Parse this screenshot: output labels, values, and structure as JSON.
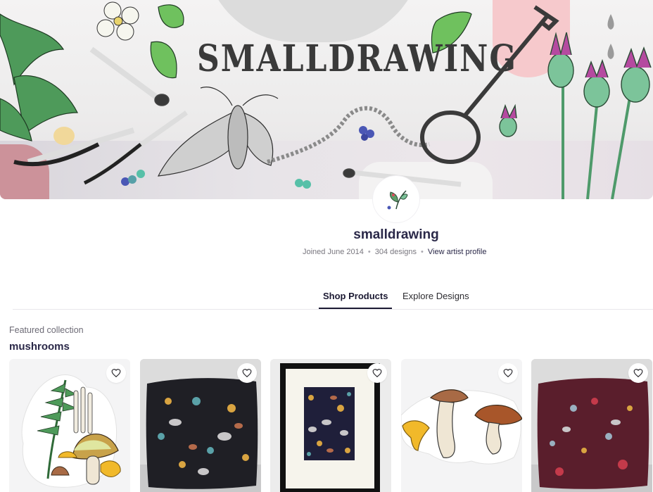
{
  "banner": {
    "title": "SMALLDRAWING"
  },
  "artist": {
    "name": "smalldrawing",
    "joined": "Joined June 2014",
    "designs": "304 designs",
    "profile_link": "View artist profile"
  },
  "tabs": [
    {
      "label": "Shop Products",
      "active": true
    },
    {
      "label": "Explore Designs",
      "active": false
    }
  ],
  "featured": {
    "label": "Featured collection",
    "title": "mushrooms"
  },
  "products": [
    {
      "kind": "sticker",
      "favorite_icon": "heart-icon"
    },
    {
      "kind": "throw-pillow",
      "favorite_icon": "heart-icon"
    },
    {
      "kind": "framed-print",
      "favorite_icon": "heart-icon"
    },
    {
      "kind": "sticker",
      "favorite_icon": "heart-icon"
    },
    {
      "kind": "throw-pillow",
      "favorite_icon": "heart-icon"
    }
  ],
  "colors": {
    "accent": "#1c1a33",
    "banner_pink": "#f6c9cc",
    "pillow_dark": "#1f1f25",
    "pillow_plum": "#5a1e2c",
    "frame": "#111111"
  }
}
